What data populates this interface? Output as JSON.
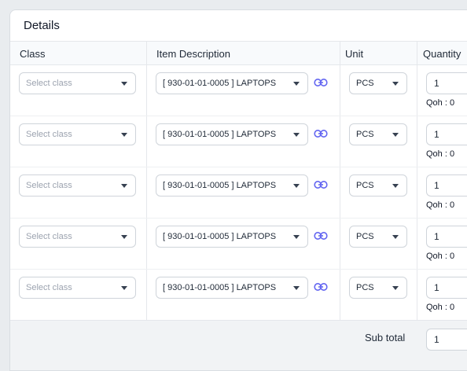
{
  "section_title": "Details",
  "columns": {
    "class": "Class",
    "item": "Item Description",
    "unit": "Unit",
    "quantity": "Quantity"
  },
  "rows": [
    {
      "class_placeholder": "Select class",
      "item": "[ 930-01-01-0005 ] LAPTOPS",
      "unit": "PCS",
      "quantity": "1",
      "qoh": "Qoh : 0"
    },
    {
      "class_placeholder": "Select class",
      "item": "[ 930-01-01-0005 ] LAPTOPS",
      "unit": "PCS",
      "quantity": "1",
      "qoh": "Qoh : 0"
    },
    {
      "class_placeholder": "Select class",
      "item": "[ 930-01-01-0005 ] LAPTOPS",
      "unit": "PCS",
      "quantity": "1",
      "qoh": "Qoh : 0"
    },
    {
      "class_placeholder": "Select class",
      "item": "[ 930-01-01-0005 ] LAPTOPS",
      "unit": "PCS",
      "quantity": "1",
      "qoh": "Qoh : 0"
    },
    {
      "class_placeholder": "Select class",
      "item": "[ 930-01-01-0005 ] LAPTOPS",
      "unit": "PCS",
      "quantity": "1",
      "qoh": "Qoh : 0"
    }
  ],
  "footer": {
    "subtotal_label": "Sub total",
    "subtotal_value": "1"
  },
  "icons": {
    "dropdown": "caret-down-icon",
    "link": "link-icon"
  },
  "colors": {
    "link_icon": "#6366f1",
    "header_bg": "#f8fafc",
    "footer_bg": "#f1f3f5"
  }
}
